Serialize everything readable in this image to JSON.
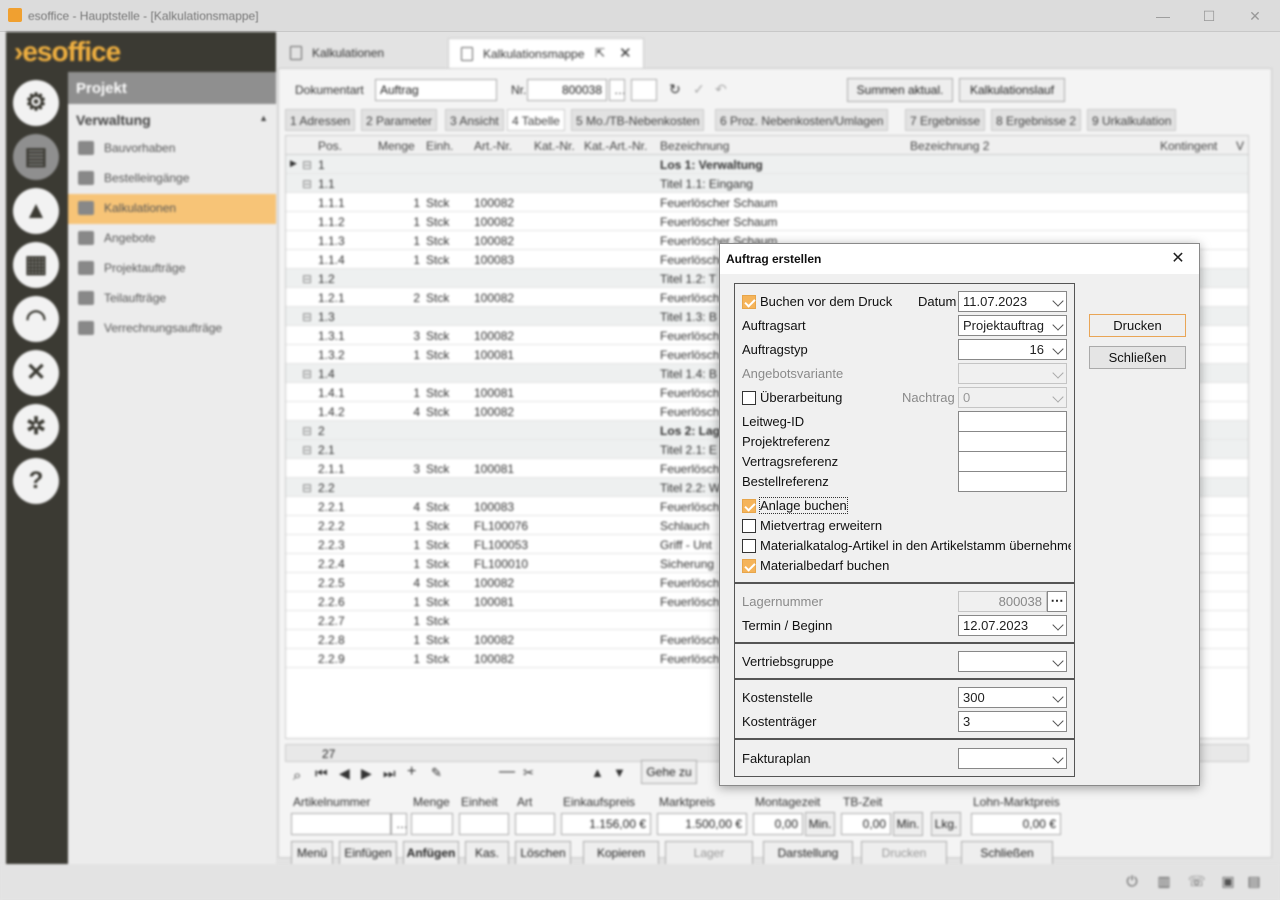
{
  "window": {
    "title": "esoffice - Hauptstelle - [Kalkulationsmappe]",
    "min_glyph": "—",
    "max_glyph": "☐",
    "close_glyph": "✕"
  },
  "brand": {
    "logo": "›esoffice"
  },
  "nav": {
    "header": "Projekt",
    "section": "Verwaltung",
    "items": [
      {
        "label": "Bauvorhaben",
        "icon": "truck-icon"
      },
      {
        "label": "Bestelleingänge",
        "icon": "cart-icon"
      },
      {
        "label": "Kalkulationen",
        "icon": "calculator-icon"
      },
      {
        "label": "Angebote",
        "icon": "hand-icon"
      },
      {
        "label": "Projektaufträge",
        "icon": "check-circle-icon"
      },
      {
        "label": "Teilaufträge",
        "icon": "stack-icon"
      },
      {
        "label": "Verrechnungsaufträge",
        "icon": "document-lock-icon"
      }
    ]
  },
  "tabs": {
    "t1": "Kalkulationen",
    "t2": "Kalkulationsmappe"
  },
  "toolbar": {
    "doc_label": "Dokumentart",
    "doc_value": "Auftrag",
    "nr_label": "Nr.",
    "nr_value": "800038",
    "summen": "Summen aktual.",
    "kalklauf": "Kalkulationslauf"
  },
  "subtabs": [
    "1 Adressen",
    "2 Parameter",
    "3 Ansicht",
    "4 Tabelle",
    "5 Mo./TB-Nebenkosten",
    "6 Proz. Nebenkosten/Umlagen",
    "7 Ergebnisse",
    "8 Ergebnisse 2",
    "9 Urkalkulation"
  ],
  "grid": {
    "columns": [
      "Pos.",
      "Menge",
      "Einh.",
      "Art.-Nr.",
      "Kat.-Nr.",
      "Kat.-Art.-Nr.",
      "Bezeichnung",
      "Bezeichnung 2",
      "Kontingent",
      "V"
    ],
    "rows": [
      {
        "pos": "1",
        "menge": "",
        "einh": "",
        "art": "",
        "bez": "Los 1: Verwaltung",
        "grp": true,
        "bold": true
      },
      {
        "pos": "1.1",
        "menge": "",
        "einh": "",
        "art": "",
        "bez": "Titel 1.1: Eingang",
        "grp": true
      },
      {
        "pos": "1.1.1",
        "menge": "1",
        "einh": "Stck",
        "art": "100082",
        "bez": "Feuerlöscher Schaum"
      },
      {
        "pos": "1.1.2",
        "menge": "1",
        "einh": "Stck",
        "art": "100082",
        "bez": "Feuerlöscher Schaum"
      },
      {
        "pos": "1.1.3",
        "menge": "1",
        "einh": "Stck",
        "art": "100082",
        "bez": "Feuerlöscher Schaum"
      },
      {
        "pos": "1.1.4",
        "menge": "1",
        "einh": "Stck",
        "art": "100083",
        "bez": "Feuerlöscher"
      },
      {
        "pos": "1.2",
        "menge": "",
        "einh": "",
        "art": "",
        "bez": "Titel 1.2: T",
        "grp": true
      },
      {
        "pos": "1.2.1",
        "menge": "2",
        "einh": "Stck",
        "art": "100082",
        "bez": "Feuerlösch"
      },
      {
        "pos": "1.3",
        "menge": "",
        "einh": "",
        "art": "",
        "bez": "Titel 1.3: B",
        "grp": true
      },
      {
        "pos": "1.3.1",
        "menge": "3",
        "einh": "Stck",
        "art": "100082",
        "bez": "Feuerlösch"
      },
      {
        "pos": "1.3.2",
        "menge": "1",
        "einh": "Stck",
        "art": "100081",
        "bez": "Feuerlösch"
      },
      {
        "pos": "1.4",
        "menge": "",
        "einh": "",
        "art": "",
        "bez": "Titel 1.4: B",
        "grp": true
      },
      {
        "pos": "1.4.1",
        "menge": "1",
        "einh": "Stck",
        "art": "100081",
        "bez": "Feuerlösch"
      },
      {
        "pos": "1.4.2",
        "menge": "4",
        "einh": "Stck",
        "art": "100082",
        "bez": "Feuerlösch"
      },
      {
        "pos": "2",
        "menge": "",
        "einh": "",
        "art": "",
        "bez": "Los 2: Lag",
        "grp": true
      },
      {
        "pos": "2.1",
        "menge": "",
        "einh": "",
        "art": "",
        "bez": "Titel 2.1: E",
        "grp": true
      },
      {
        "pos": "2.1.1",
        "menge": "3",
        "einh": "Stck",
        "art": "100081",
        "bez": "Feuerlösch"
      },
      {
        "pos": "2.2",
        "menge": "",
        "einh": "",
        "art": "",
        "bez": "Titel 2.2: W",
        "grp": true
      },
      {
        "pos": "2.2.1",
        "menge": "4",
        "einh": "Stck",
        "art": "100083",
        "bez": "Feuerlösch"
      },
      {
        "pos": "2.2.2",
        "menge": "1",
        "einh": "Stck",
        "art": "FL100076",
        "bez": "Schlauch"
      },
      {
        "pos": "2.2.3",
        "menge": "1",
        "einh": "Stck",
        "art": "FL100053",
        "bez": "Griff - Unt"
      },
      {
        "pos": "2.2.4",
        "menge": "1",
        "einh": "Stck",
        "art": "FL100010",
        "bez": "Sicherung"
      },
      {
        "pos": "2.2.5",
        "menge": "4",
        "einh": "Stck",
        "art": "100082",
        "bez": "Feuerlösch"
      },
      {
        "pos": "2.2.6",
        "menge": "1",
        "einh": "Stck",
        "art": "100081",
        "bez": "Feuerlösch"
      },
      {
        "pos": "2.2.7",
        "menge": "1",
        "einh": "Stck",
        "art": "",
        "bez": ""
      },
      {
        "pos": "2.2.8",
        "menge": "1",
        "einh": "Stck",
        "art": "100082",
        "bez": "Feuerlösch"
      },
      {
        "pos": "2.2.9",
        "menge": "1",
        "einh": "Stck",
        "art": "100082",
        "bez": "Feuerlösch"
      }
    ],
    "count": "27"
  },
  "navtools": {
    "gehe_zu": "Gehe zu"
  },
  "bottom": {
    "artikelnummer": "Artikelnummer",
    "menge": "Menge",
    "einheit": "Einheit",
    "art": "Art",
    "ek_label": "Einkaufspreis",
    "ek_value": "1.156,00 €",
    "mp_label": "Marktpreis",
    "mp_value": "1.500,00 €",
    "mz_label": "Montagezeit",
    "mz_value": "0,00",
    "mz_unit": "Min.",
    "tb_label": "TB-Zeit",
    "tb_value": "0,00",
    "tb_unit": "Min.",
    "lkg": "Lkg.",
    "lm_label": "Lohn-Marktpreis",
    "lm_value": "0,00 €",
    "buttons": [
      "Menü",
      "Einfügen",
      "Anfügen",
      "Kas.",
      "Löschen",
      "Kopieren",
      "Lager",
      "Darstellung",
      "Drucken",
      "Schließen"
    ]
  },
  "dialog": {
    "title": "Auftrag erstellen",
    "buchen_vor_druck": "Buchen vor dem Druck",
    "datum_label": "Datum",
    "datum_value": "11.07.2023",
    "auftragsart_label": "Auftragsart",
    "auftragsart_value": "Projektauftrag",
    "auftragstyp_label": "Auftragstyp",
    "auftragstyp_value": "16",
    "angebotsvariante_label": "Angebotsvariante",
    "ueberarbeitung_label": "Überarbeitung",
    "nachtrag_label": "Nachtrag",
    "nachtrag_value": "0",
    "leitweg_label": "Leitweg-ID",
    "projektref_label": "Projektreferenz",
    "vertragsref_label": "Vertragsreferenz",
    "bestellref_label": "Bestellreferenz",
    "anlage_buchen": "Anlage buchen",
    "mietvertrag": "Mietvertrag erweitern",
    "materialkatalog": "Materialkatalog-Artikel in den Artikelstamm übernehmen",
    "materialbedarf": "Materialbedarf buchen",
    "lagernummer_label": "Lagernummer",
    "lagernummer_value": "800038",
    "termin_label": "Termin / Beginn",
    "termin_value": "12.07.2023",
    "vertriebsgruppe_label": "Vertriebsgruppe",
    "kostenstelle_label": "Kostenstelle",
    "kostenstelle_value": "300",
    "kostentraeger_label": "Kostenträger",
    "kostentraeger_value": "3",
    "fakturaplan_label": "Fakturaplan",
    "drucken": "Drucken",
    "schliessen": "Schließen",
    "close_glyph": "✕"
  },
  "colors": {
    "accent": "#f5b45a",
    "sidebar": "#3b3a33",
    "nav_selected": "#f7c477"
  }
}
